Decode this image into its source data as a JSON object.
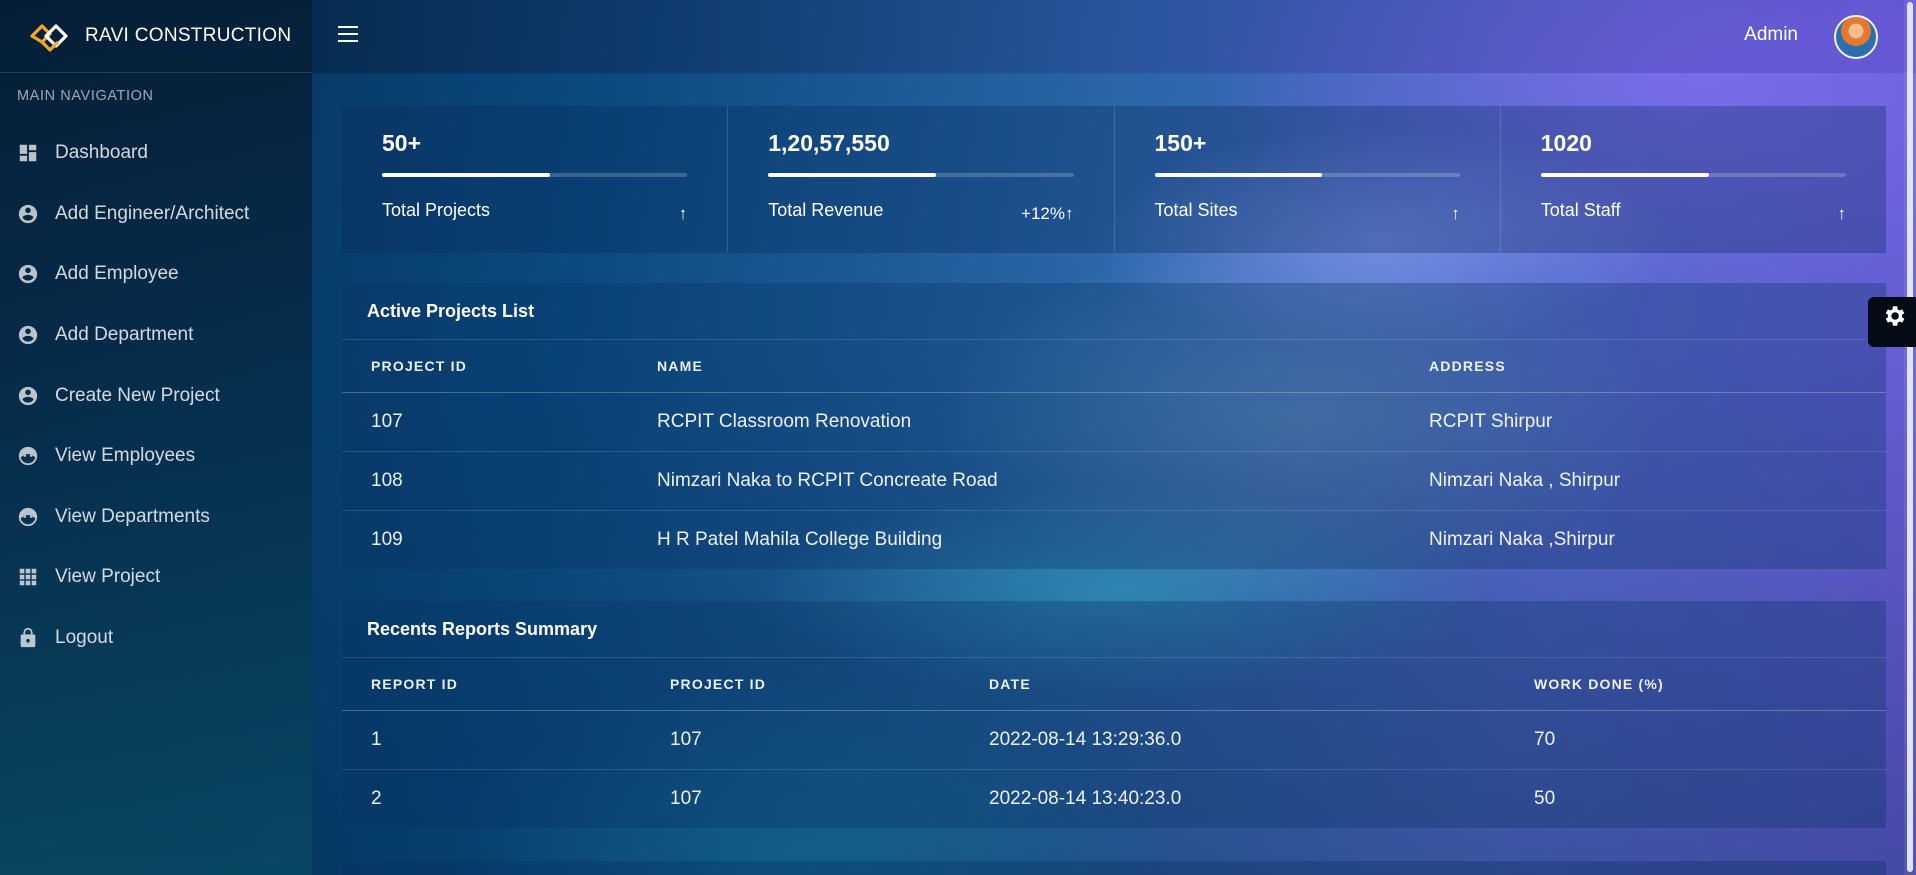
{
  "brand": {
    "name": "RAVI CONSTRUCTION",
    "logo_icon": "logo-icon"
  },
  "sidebar": {
    "heading": "MAIN NAVIGATION",
    "items": [
      {
        "label": "Dashboard",
        "icon": "dashboard-icon"
      },
      {
        "label": "Add Engineer/Architect",
        "icon": "user-circle-icon"
      },
      {
        "label": "Add Employee",
        "icon": "user-circle-icon"
      },
      {
        "label": "Add Department",
        "icon": "user-circle-icon"
      },
      {
        "label": "Create New Project",
        "icon": "user-circle-icon"
      },
      {
        "label": "View Employees",
        "icon": "face-icon"
      },
      {
        "label": "View Departments",
        "icon": "face-icon"
      },
      {
        "label": "View Project",
        "icon": "grid-icon"
      },
      {
        "label": "Logout",
        "icon": "lock-icon"
      }
    ]
  },
  "topbar": {
    "user_label": "Admin",
    "menu_icon": "hamburger-icon",
    "avatar": "avatar"
  },
  "stats": [
    {
      "value": "50+",
      "label": "Total Projects",
      "trend": "↑",
      "progress": 0.55
    },
    {
      "value": "1,20,57,550",
      "label": "Total Revenue",
      "trend": "+12%↑",
      "progress": 0.55
    },
    {
      "value": "150+",
      "label": "Total Sites",
      "trend": "↑",
      "progress": 0.55
    },
    {
      "value": "1020",
      "label": "Total Staff",
      "trend": "↑",
      "progress": 0.55
    }
  ],
  "active_projects": {
    "title": "Active Projects List",
    "columns": [
      "PROJECT ID",
      "NAME",
      "ADDRESS"
    ],
    "rows": [
      [
        "107",
        "RCPIT Classroom Renovation",
        "RCPIT Shirpur"
      ],
      [
        "108",
        "Nimzari Naka to RCPIT Concreate Road",
        "Nimzari Naka , Shirpur"
      ],
      [
        "109",
        "H R Patel Mahila College Building",
        "Nimzari Naka ,Shirpur"
      ]
    ]
  },
  "reports": {
    "title": "Recents Reports Summary",
    "columns": [
      "REPORT ID",
      "PROJECT ID",
      "DATE",
      "WORK DONE (%)"
    ],
    "rows": [
      [
        "1",
        "107",
        "2022-08-14 13:29:36.0",
        "70"
      ],
      [
        "2",
        "107",
        "2022-08-14 13:40:23.0",
        "50"
      ]
    ]
  },
  "settings_icon": "gear-icon"
}
